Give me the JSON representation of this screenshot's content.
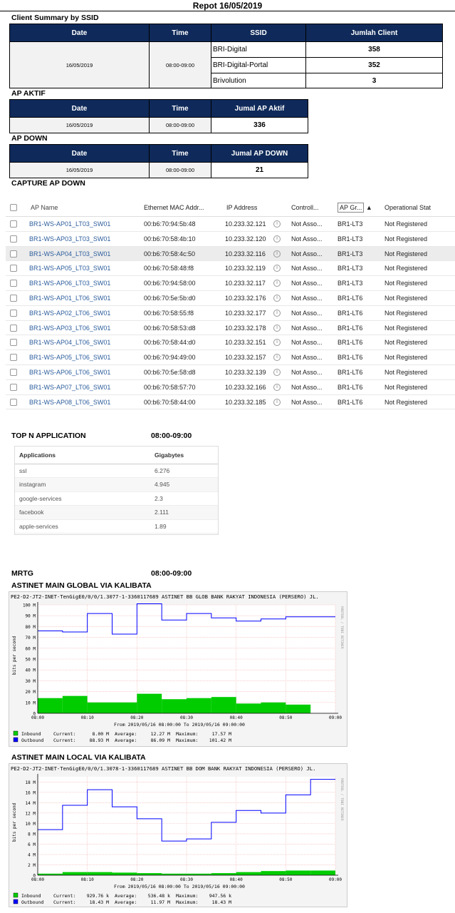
{
  "report_title": "Repot 16/05/2019",
  "client_summary": {
    "label": "Client Summary by SSID",
    "headers": [
      "Date",
      "Time",
      "SSID",
      "Jumlah Client"
    ],
    "date": "16/05/2019",
    "time": "08:00-09:00",
    "rows": [
      {
        "ssid": "BRI-Digital",
        "count": "358"
      },
      {
        "ssid": "BRI-Digital-Portal",
        "count": "352"
      },
      {
        "ssid": "Brivolution",
        "count": "3"
      }
    ]
  },
  "ap_aktif": {
    "label": "AP AKTIF",
    "headers": [
      "Date",
      "Time",
      "Jumal AP Aktif"
    ],
    "date": "16/05/2019",
    "time": "08:00-09:00",
    "value": "336"
  },
  "ap_down": {
    "label": "AP DOWN",
    "headers": [
      "Date",
      "Time",
      "Jumal AP DOWN"
    ],
    "date": "16/05/2019",
    "time": "08:00-09:00",
    "value": "21"
  },
  "capture": {
    "label": "CAPTURE AP DOWN",
    "headers": {
      "name": "AP Name",
      "mac": "Ethernet MAC Addr...",
      "ip": "IP Address",
      "ctl": "Controll...",
      "grp": "AP Gr...",
      "sort": "▲",
      "op": "Operational Stat"
    },
    "info_glyph": "i",
    "rows": [
      {
        "name": "BR1-WS-AP01_LT03_SW01",
        "mac": "00:b6:70:94:5b:48",
        "ip": "10.233.32.121",
        "ctl": "Not Asso...",
        "grp": "BR1-LT3",
        "op": "Not Registered"
      },
      {
        "name": "BR1-WS-AP03_LT03_SW01",
        "mac": "00:b6:70:58:4b:10",
        "ip": "10.233.32.120",
        "ctl": "Not Asso...",
        "grp": "BR1-LT3",
        "op": "Not Registered"
      },
      {
        "name": "BR1-WS-AP04_LT03_SW01",
        "mac": "00:b6:70:58:4c:50",
        "ip": "10.233.32.116",
        "ctl": "Not Asso...",
        "grp": "BR1-LT3",
        "op": "Not Registered"
      },
      {
        "name": "BR1-WS-AP05_LT03_SW01",
        "mac": "00:b6:70:58:48:f8",
        "ip": "10.233.32.119",
        "ctl": "Not Asso...",
        "grp": "BR1-LT3",
        "op": "Not Registered"
      },
      {
        "name": "BR1-WS-AP06_LT03_SW01",
        "mac": "00:b6:70:94:58:00",
        "ip": "10.233.32.117",
        "ctl": "Not Asso...",
        "grp": "BR1-LT3",
        "op": "Not Registered"
      },
      {
        "name": "BR1-WS-AP01_LT06_SW01",
        "mac": "00:b6:70:5e:5b:d0",
        "ip": "10.233.32.176",
        "ctl": "Not Asso...",
        "grp": "BR1-LT6",
        "op": "Not Registered"
      },
      {
        "name": "BR1-WS-AP02_LT06_SW01",
        "mac": "00:b6:70:58:55:f8",
        "ip": "10.233.32.177",
        "ctl": "Not Asso...",
        "grp": "BR1-LT6",
        "op": "Not Registered"
      },
      {
        "name": "BR1-WS-AP03_LT06_SW01",
        "mac": "00:b6:70:58:53:d8",
        "ip": "10.233.32.178",
        "ctl": "Not Asso...",
        "grp": "BR1-LT6",
        "op": "Not Registered"
      },
      {
        "name": "BR1-WS-AP04_LT06_SW01",
        "mac": "00:b6:70:58:44:d0",
        "ip": "10.233.32.151",
        "ctl": "Not Asso...",
        "grp": "BR1-LT6",
        "op": "Not Registered"
      },
      {
        "name": "BR1-WS-AP05_LT06_SW01",
        "mac": "00:b6:70:94:49:00",
        "ip": "10.233.32.157",
        "ctl": "Not Asso...",
        "grp": "BR1-LT6",
        "op": "Not Registered"
      },
      {
        "name": "BR1-WS-AP06_LT06_SW01",
        "mac": "00:b6:70:5e:58:d8",
        "ip": "10.233.32.139",
        "ctl": "Not Asso...",
        "grp": "BR1-LT6",
        "op": "Not Registered"
      },
      {
        "name": "BR1-WS-AP07_LT06_SW01",
        "mac": "00:b6:70:58:57:70",
        "ip": "10.233.32.166",
        "ctl": "Not Asso...",
        "grp": "BR1-LT6",
        "op": "Not Registered"
      },
      {
        "name": "BR1-WS-AP08_LT06_SW01",
        "mac": "00:b6:70:58:44:00",
        "ip": "10.233.32.185",
        "ctl": "Not Asso...",
        "grp": "BR1-LT6",
        "op": "Not Registered"
      }
    ]
  },
  "topn": {
    "label": "TOP N APPLICATION",
    "time": "08:00-09:00",
    "headers": [
      "Applications",
      "Gigabytes"
    ],
    "rows": [
      {
        "app": "ssl",
        "gb": "6.276"
      },
      {
        "app": "instagram",
        "gb": "4.945"
      },
      {
        "app": "google-services",
        "gb": "2.3"
      },
      {
        "app": "facebook",
        "gb": "2.111"
      },
      {
        "app": "apple-services",
        "gb": "1.89"
      }
    ]
  },
  "mrtg_label": "MRTG",
  "mrtg_time": "08:00-09:00",
  "colors": {
    "header_navy": "#0f2a5a",
    "inbound": "#00cc00",
    "outbound": "#0000ff",
    "link": "#2c5d9c"
  },
  "chart_data": [
    {
      "type": "area",
      "title": "ASTINET MAIN GLOBAL VIA KALIBATA",
      "subtitle": "PE2-D2-JT2-INET-TenGigE0/0/0/1.3077-1-3360117689 ASTINET BB GLOB BANK RAKYAT INDONESIA (PERSERO) JL.",
      "ylabel": "bits per second",
      "side_label": "RRDTOOL / TOBI OETIKER",
      "ylim": [
        0,
        100
      ],
      "yticks": [
        "0",
        "10 M",
        "20 M",
        "30 M",
        "40 M",
        "50 M",
        "60 M",
        "70 M",
        "80 M",
        "90 M",
        "100 M"
      ],
      "xticks": [
        "08:00",
        "08:10",
        "08:20",
        "08:30",
        "08:40",
        "08:50",
        "09:00"
      ],
      "range_text": "From 2019/05/16 08:00:00 To 2019/05/16 09:00:00",
      "x": [
        0,
        5,
        10,
        15,
        20,
        25,
        30,
        35,
        40,
        45,
        50,
        55
      ],
      "series": [
        {
          "name": "Inbound",
          "values": [
            14,
            16,
            10,
            10,
            18,
            13,
            14,
            15,
            9,
            10,
            8,
            0
          ]
        },
        {
          "name": "Outbound",
          "values": [
            76,
            75,
            92,
            73,
            101,
            86,
            92,
            88,
            85,
            87,
            89,
            89
          ]
        }
      ],
      "legend": [
        {
          "name": "Inbound",
          "current": "8.00 M",
          "average": "12.27 M",
          "maximum": "17.57 M"
        },
        {
          "name": "Outbound",
          "current": "88.93 M",
          "average": "86.09 M",
          "maximum": "101.42 M"
        }
      ]
    },
    {
      "type": "area",
      "title": "ASTINET MAIN LOCAL VIA KALIBATA",
      "subtitle": "PE2-D2-JT2-INET-TenGigE0/0/0/1.3078-1-3360117689 ASTINET BB DOM BANK RAKYAT INDONESIA (PERSERO) JL.",
      "ylabel": "bits per second",
      "side_label": "RRDTOOL / TOBI OETIKER",
      "ylim": [
        0,
        19
      ],
      "yticks": [
        "0",
        "2 M",
        "4 M",
        "6 M",
        "8 M",
        "10 M",
        "12 M",
        "14 M",
        "16 M",
        "18 M"
      ],
      "xticks": [
        "08:00",
        "08:10",
        "08:20",
        "08:30",
        "08:40",
        "08:50",
        "09:00"
      ],
      "range_text": "From 2019/05/16 08:00:00 To 2019/05/16 09:00:00",
      "x": [
        0,
        5,
        10,
        15,
        20,
        25,
        30,
        35,
        40,
        45,
        50,
        55
      ],
      "series": [
        {
          "name": "Inbound",
          "values": [
            0.3,
            0.6,
            0.6,
            0.5,
            0.4,
            0.3,
            0.3,
            0.4,
            0.6,
            0.8,
            0.9,
            0.9
          ]
        },
        {
          "name": "Outbound",
          "values": [
            8.8,
            13.5,
            16.5,
            13.2,
            10.9,
            6.6,
            7.0,
            10.2,
            12.5,
            12.0,
            15.5,
            18.5
          ]
        }
      ],
      "legend": [
        {
          "name": "Inbound",
          "current": "929.76 k",
          "average": "536.48 k",
          "maximum": "947.56 k"
        },
        {
          "name": "Outbound",
          "current": "18.43 M",
          "average": "11.97 M",
          "maximum": "18.43 M"
        }
      ]
    }
  ]
}
